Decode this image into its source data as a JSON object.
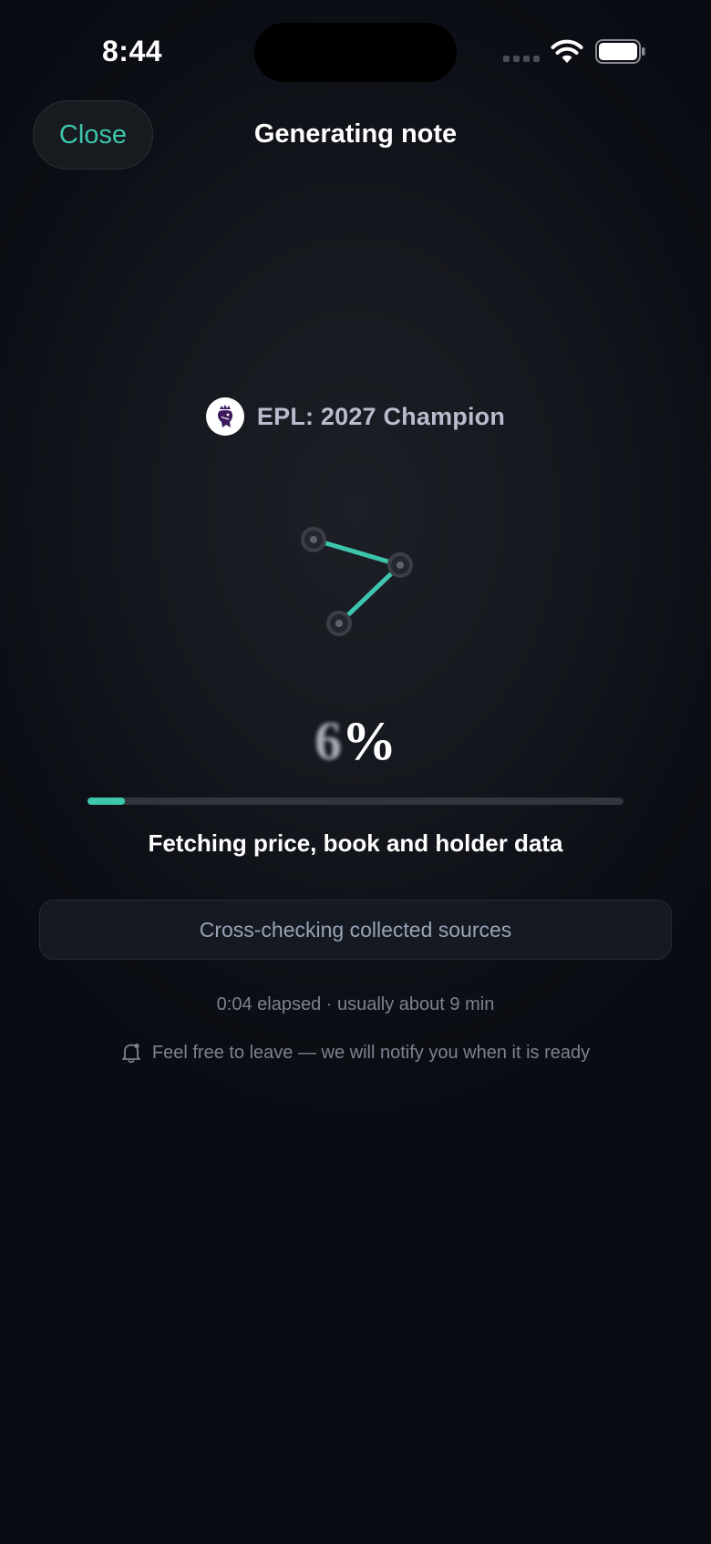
{
  "status_bar": {
    "time": "8:44",
    "icons": [
      "cellular-dots-icon",
      "wifi-icon",
      "battery-icon"
    ]
  },
  "header": {
    "close_label": "Close",
    "title": "Generating note"
  },
  "market": {
    "logo_icon": "premier-league-lion-icon",
    "name": "EPL: 2027 Champion"
  },
  "progress": {
    "digit": "6",
    "percent_symbol": "%",
    "bar_fraction": 0.07,
    "stage_label": "Fetching price, book and holder data",
    "substep": "Cross-checking collected sources",
    "elapsed": "0:04 elapsed · usually about 9 min"
  },
  "notice": {
    "icon": "bell-icon",
    "text": "Feel free to leave — we will notify you when it is ready"
  },
  "colors": {
    "accent": "#3dc6ac",
    "background": "#0b0d14",
    "pill_background": "#141922"
  }
}
